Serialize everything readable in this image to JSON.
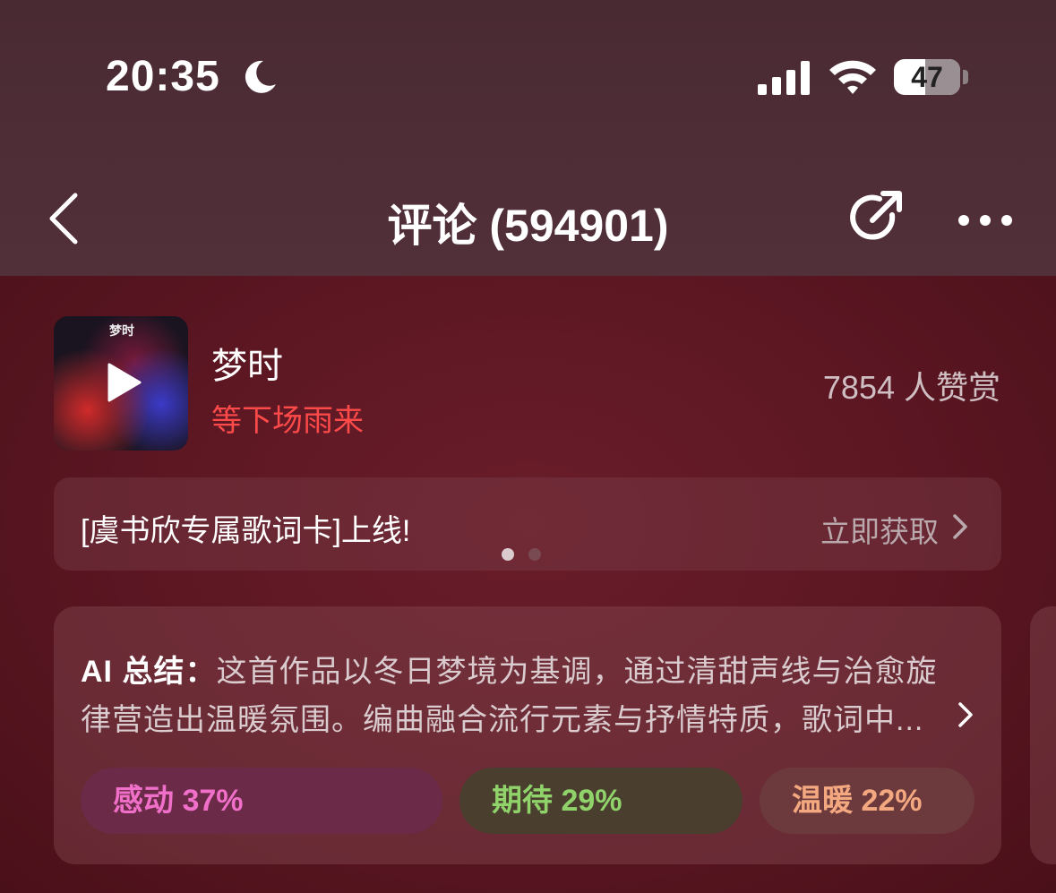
{
  "status_bar": {
    "time": "20:35",
    "battery": "47",
    "battery_level": 0.47
  },
  "nav": {
    "title": "评论 (594901)"
  },
  "song": {
    "cover_text": "梦时",
    "title": "梦时",
    "artist": "等下场雨来",
    "praise_count": "7854 人赞赏"
  },
  "banner": {
    "text": "[虞书欣专属歌词卡]上线!",
    "action": "立即获取",
    "page_index": 0,
    "page_count": 2
  },
  "ai_summary": {
    "label": "AI 总结：",
    "text": "这首作品以冬日梦境为基调，通过清甜声线与治愈旋律营造出温暖氛围。编曲融合流行元素与抒情特质，歌词中..."
  },
  "tags": [
    {
      "label": "感动 37%",
      "color": "#f06fc8",
      "bg": "#6b2a48"
    },
    {
      "label": "期待 29%",
      "color": "#8fd36a",
      "bg": "#4a3f2e"
    },
    {
      "label": "温暖 22%",
      "color": "#f4a880",
      "bg": "#6c3a3c"
    }
  ],
  "colors": {
    "artist_red": "#ff4a4a",
    "muted_text": "#cfbfc3"
  },
  "icons": [
    "moon-icon",
    "signal-icon",
    "wifi-icon",
    "back-icon",
    "share-icon",
    "more-icon",
    "play-icon",
    "chevron-right-icon"
  ]
}
